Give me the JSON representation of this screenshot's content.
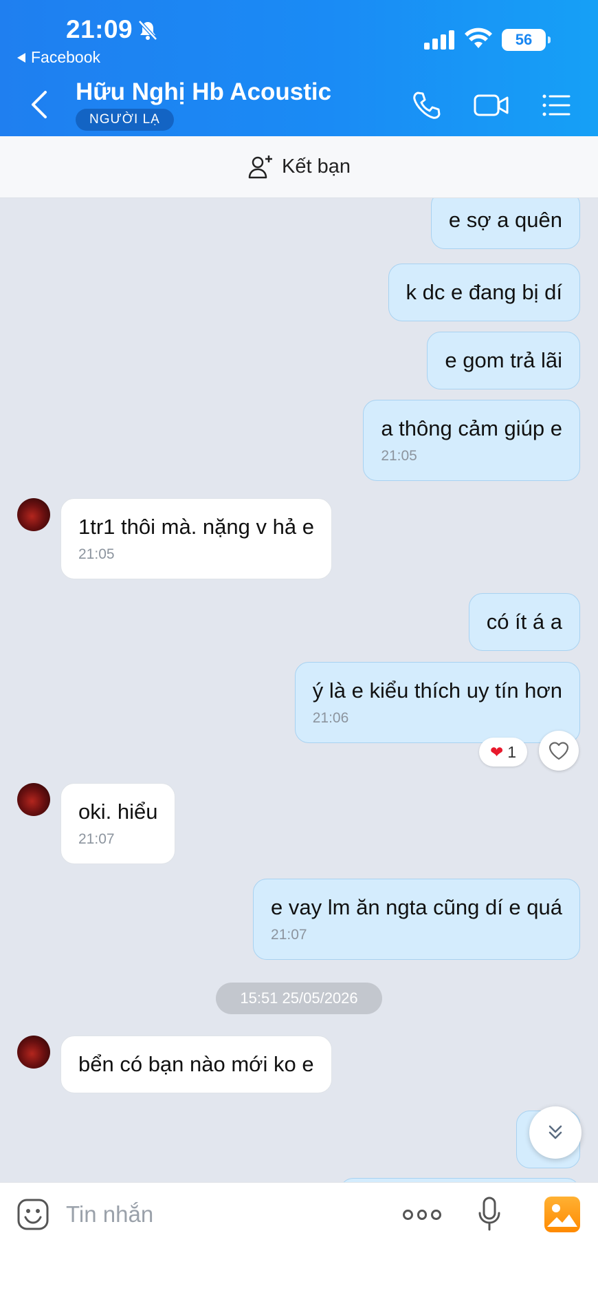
{
  "status_bar": {
    "time": "21:09",
    "back_app": "Facebook",
    "battery": "56"
  },
  "header": {
    "contact_name": "Hữu Nghị Hb Acoustic",
    "badge": "NGƯỜI LẠ"
  },
  "friend_bar": {
    "label": "Kết bạn"
  },
  "messages": [
    {
      "dir": "out",
      "text": "e sợ a quên"
    },
    {
      "dir": "out",
      "text": "k dc e đang bị dí"
    },
    {
      "dir": "out",
      "text": "e gom trả lãi"
    },
    {
      "dir": "out",
      "text": "a thông cảm giúp e",
      "time": "21:05"
    },
    {
      "dir": "in",
      "text": "1tr1 thôi mà. nặng v hả e",
      "time": "21:05"
    },
    {
      "dir": "out",
      "text": "có ít á a"
    },
    {
      "dir": "out",
      "text": "ý là e kiểu thích uy tín hơn",
      "time": "21:06"
    },
    {
      "dir": "in",
      "text": "oki. hiểu",
      "time": "21:07"
    },
    {
      "dir": "out",
      "text": "e vay lm ăn ngta cũng dí e quá",
      "time": "21:07"
    },
    {
      "dir": "in",
      "text": "bển có bạn nào mới ko e"
    },
    {
      "dir": "out",
      "text": "k a"
    }
  ],
  "reaction": {
    "emoji": "❤",
    "count": "1",
    "color": "#e8192c"
  },
  "date_divider": "15:51 25/05/2026",
  "composer": {
    "placeholder": "Tin nhắn"
  },
  "colors": {
    "header_start": "#1f7ff0",
    "header_end": "#16a0f6",
    "outgoing_bubble": "#d4ecfd",
    "incoming_bubble": "#ffffff",
    "chat_bg": "#e2e6ee"
  }
}
